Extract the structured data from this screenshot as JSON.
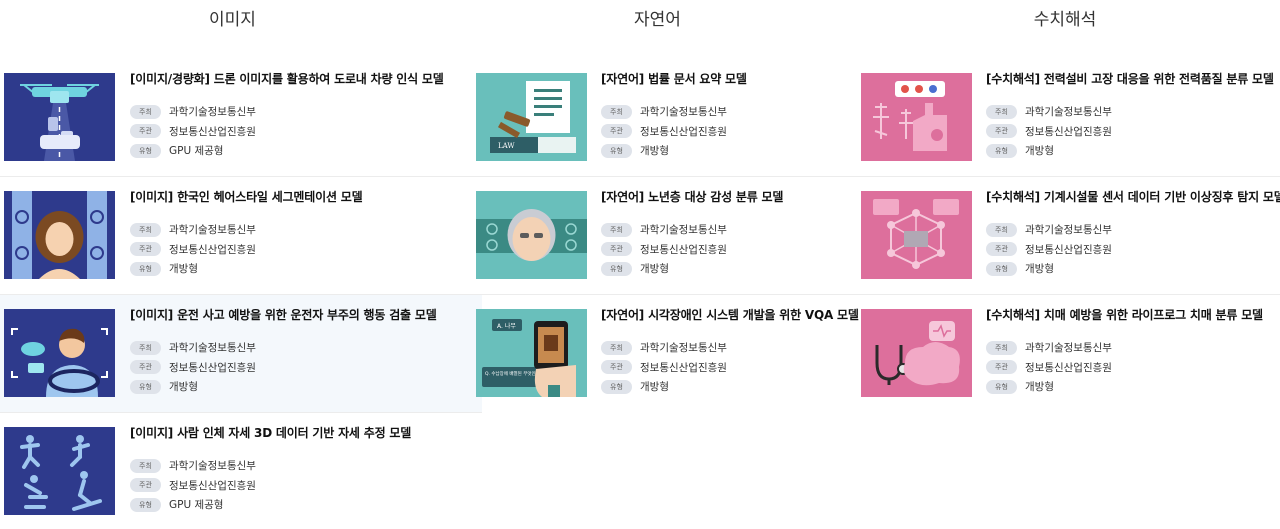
{
  "labels": {
    "host": "주최",
    "org": "주관",
    "type": "유형"
  },
  "columns": [
    {
      "title": "이미지",
      "cards": [
        {
          "title": "[이미지/경량화] 드론 이미지를 활용하여 도로내 차량 인식 모델",
          "host": "과학기술정보통신부",
          "org": "정보통신산업진흥원",
          "type": "GPU 제공형",
          "icon": "drone-icon"
        },
        {
          "title": "[이미지] 한국인 헤어스타일 세그멘테이션 모델",
          "host": "과학기술정보통신부",
          "org": "정보통신산업진흥원",
          "type": "개방형",
          "icon": "hairstyle-icon"
        },
        {
          "title": "[이미지] 운전 사고 예방을 위한 운전자 부주의 행동 검출 모델",
          "host": "과학기술정보통신부",
          "org": "정보통신산업진흥원",
          "type": "개방형",
          "icon": "driver-icon"
        },
        {
          "title": "[이미지] 사람 인체 자세 3D 데이터 기반 자세 추정 모델",
          "host": "과학기술정보통신부",
          "org": "정보통신산업진흥원",
          "type": "GPU 제공형",
          "icon": "pose-icon"
        }
      ]
    },
    {
      "title": "자연어",
      "cards": [
        {
          "title": "[자연어] 법률 문서 요약 모델",
          "host": "과학기술정보통신부",
          "org": "정보통신산업진흥원",
          "type": "개방형",
          "icon": "law-icon",
          "image_text": "LAW"
        },
        {
          "title": "[자연어] 노년층 대상 감성 분류 모델",
          "host": "과학기술정보통신부",
          "org": "정보통신산업진흥원",
          "type": "개방형",
          "icon": "elderly-emotion-icon"
        },
        {
          "title": "[자연어] 시각장애인 시스템 개발을 위한 VQA 모델",
          "host": "과학기술정보통신부",
          "org": "정보통신산업진흥원",
          "type": "개방형",
          "icon": "vqa-phone-icon",
          "image_text_a": "A. 나무",
          "image_text_q": "Q. 수납장에 배열된 무엇인가?"
        }
      ]
    },
    {
      "title": "수치해석",
      "cards": [
        {
          "title": "[수치해석] 전력설비 고장 대응을 위한 전력품질 분류 모델",
          "host": "과학기술정보통신부",
          "org": "정보통신산업진흥원",
          "type": "개방형",
          "icon": "power-facility-icon"
        },
        {
          "title": "[수치해석] 기계시설물 센서 데이터 기반 이상징후 탐지 모델",
          "host": "과학기술정보통신부",
          "org": "정보통신산업진흥원",
          "type": "개방형",
          "icon": "sensor-network-icon"
        },
        {
          "title": "[수치해석] 치매 예방을 위한 라이프로그 치매 분류 모델",
          "host": "과학기술정보통신부",
          "org": "정보통신산업진흥원",
          "type": "개방형",
          "icon": "brain-stethoscope-icon"
        }
      ]
    }
  ],
  "colors": {
    "navy": "#2e3a8c",
    "teal": "#69bfbb",
    "pink": "#dd6f9c",
    "badge_bg": "#dfe3ea"
  }
}
